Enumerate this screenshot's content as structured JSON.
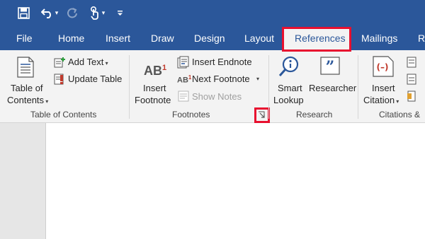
{
  "colors": {
    "brand": "#2b579a",
    "highlight": "#e8102f",
    "ribbon_bg": "#f3f3f3"
  },
  "quick_access": {
    "save_icon": "save-icon",
    "undo_icon": "undo-icon",
    "redo_icon": "redo-icon",
    "touch_mode_icon": "touch-mode-icon",
    "customize_icon": "customize-qat-icon"
  },
  "tabs": [
    {
      "label": "File"
    },
    {
      "label": "Home"
    },
    {
      "label": "Insert"
    },
    {
      "label": "Draw"
    },
    {
      "label": "Design"
    },
    {
      "label": "Layout"
    },
    {
      "label": "References"
    },
    {
      "label": "Mailings"
    },
    {
      "label": "R"
    }
  ],
  "ribbon": {
    "toc_group": {
      "toc_line1": "Table of",
      "toc_line2": "Contents",
      "add_text": "Add Text",
      "update_table": "Update Table",
      "group_label": "Table of Contents"
    },
    "footnotes_group": {
      "insert_footnote_line1": "Insert",
      "insert_footnote_line2": "Footnote",
      "insert_endnote": "Insert Endnote",
      "next_footnote": "Next Footnote",
      "show_notes": "Show Notes",
      "group_label": "Footnotes",
      "ab_glyph": "AB",
      "ab_sup": "1"
    },
    "research_group": {
      "smart_line1": "Smart",
      "smart_line2": "Lookup",
      "researcher": "Researcher",
      "group_label": "Research"
    },
    "citations_group": {
      "insert_citation_line1": "Insert",
      "insert_citation_line2": "Citation",
      "group_label": "Citations &"
    }
  }
}
